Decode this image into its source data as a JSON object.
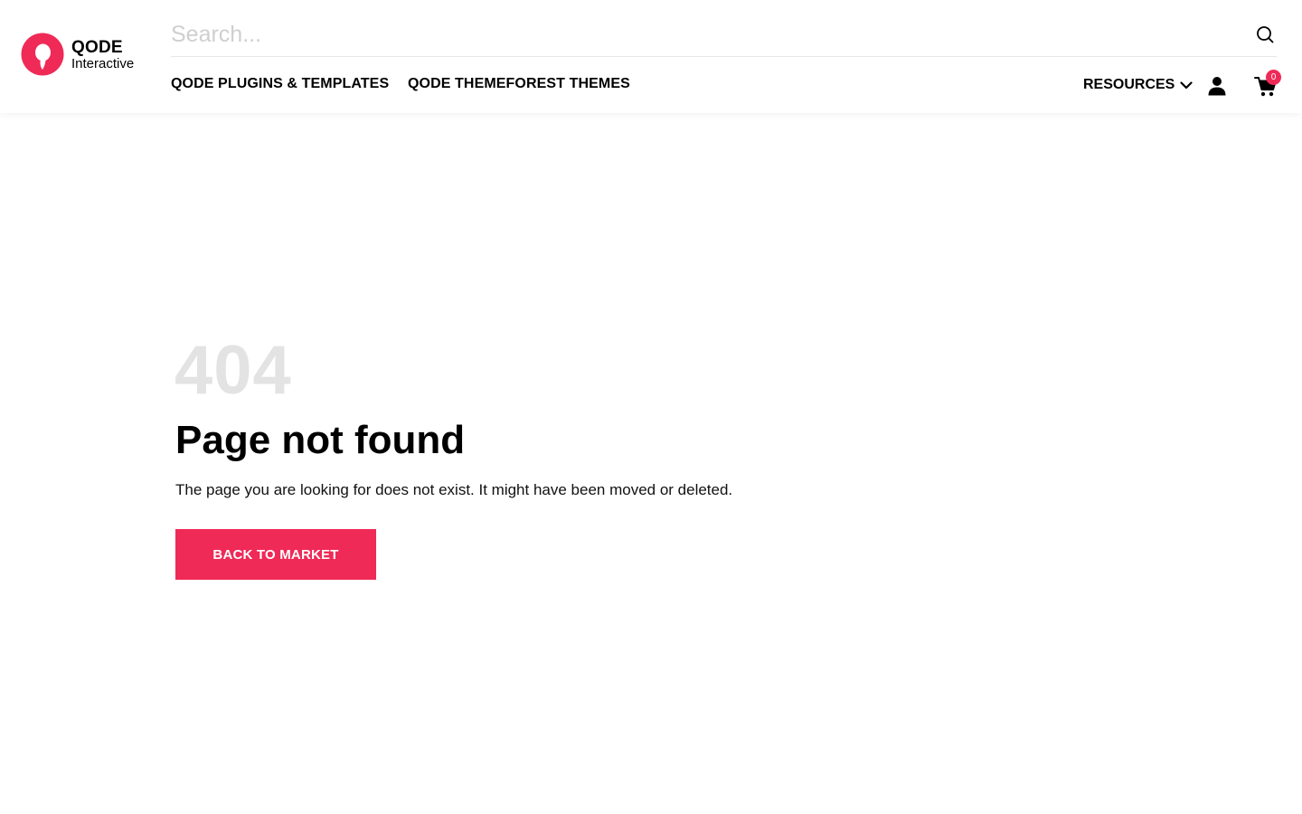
{
  "brand": {
    "name_line1": "QODE",
    "name_line2": "Interactive",
    "accent_color": "#ef2a57"
  },
  "search": {
    "placeholder": "Search...",
    "value": "",
    "icon": "search-icon"
  },
  "nav": {
    "items": [
      {
        "label": "QODE PLUGINS & TEMPLATES"
      },
      {
        "label": "QODE THEMEFOREST THEMES"
      }
    ],
    "resources_label": "RESOURCES",
    "resources_icon": "chevron-down-icon",
    "user_icon": "user-icon",
    "cart_icon": "cart-icon",
    "cart_count": "0"
  },
  "error": {
    "code": "404",
    "title": "Page not found",
    "message": "The page you are looking for does not exist. It might have been moved or deleted.",
    "button_label": "BACK TO MARKET"
  }
}
